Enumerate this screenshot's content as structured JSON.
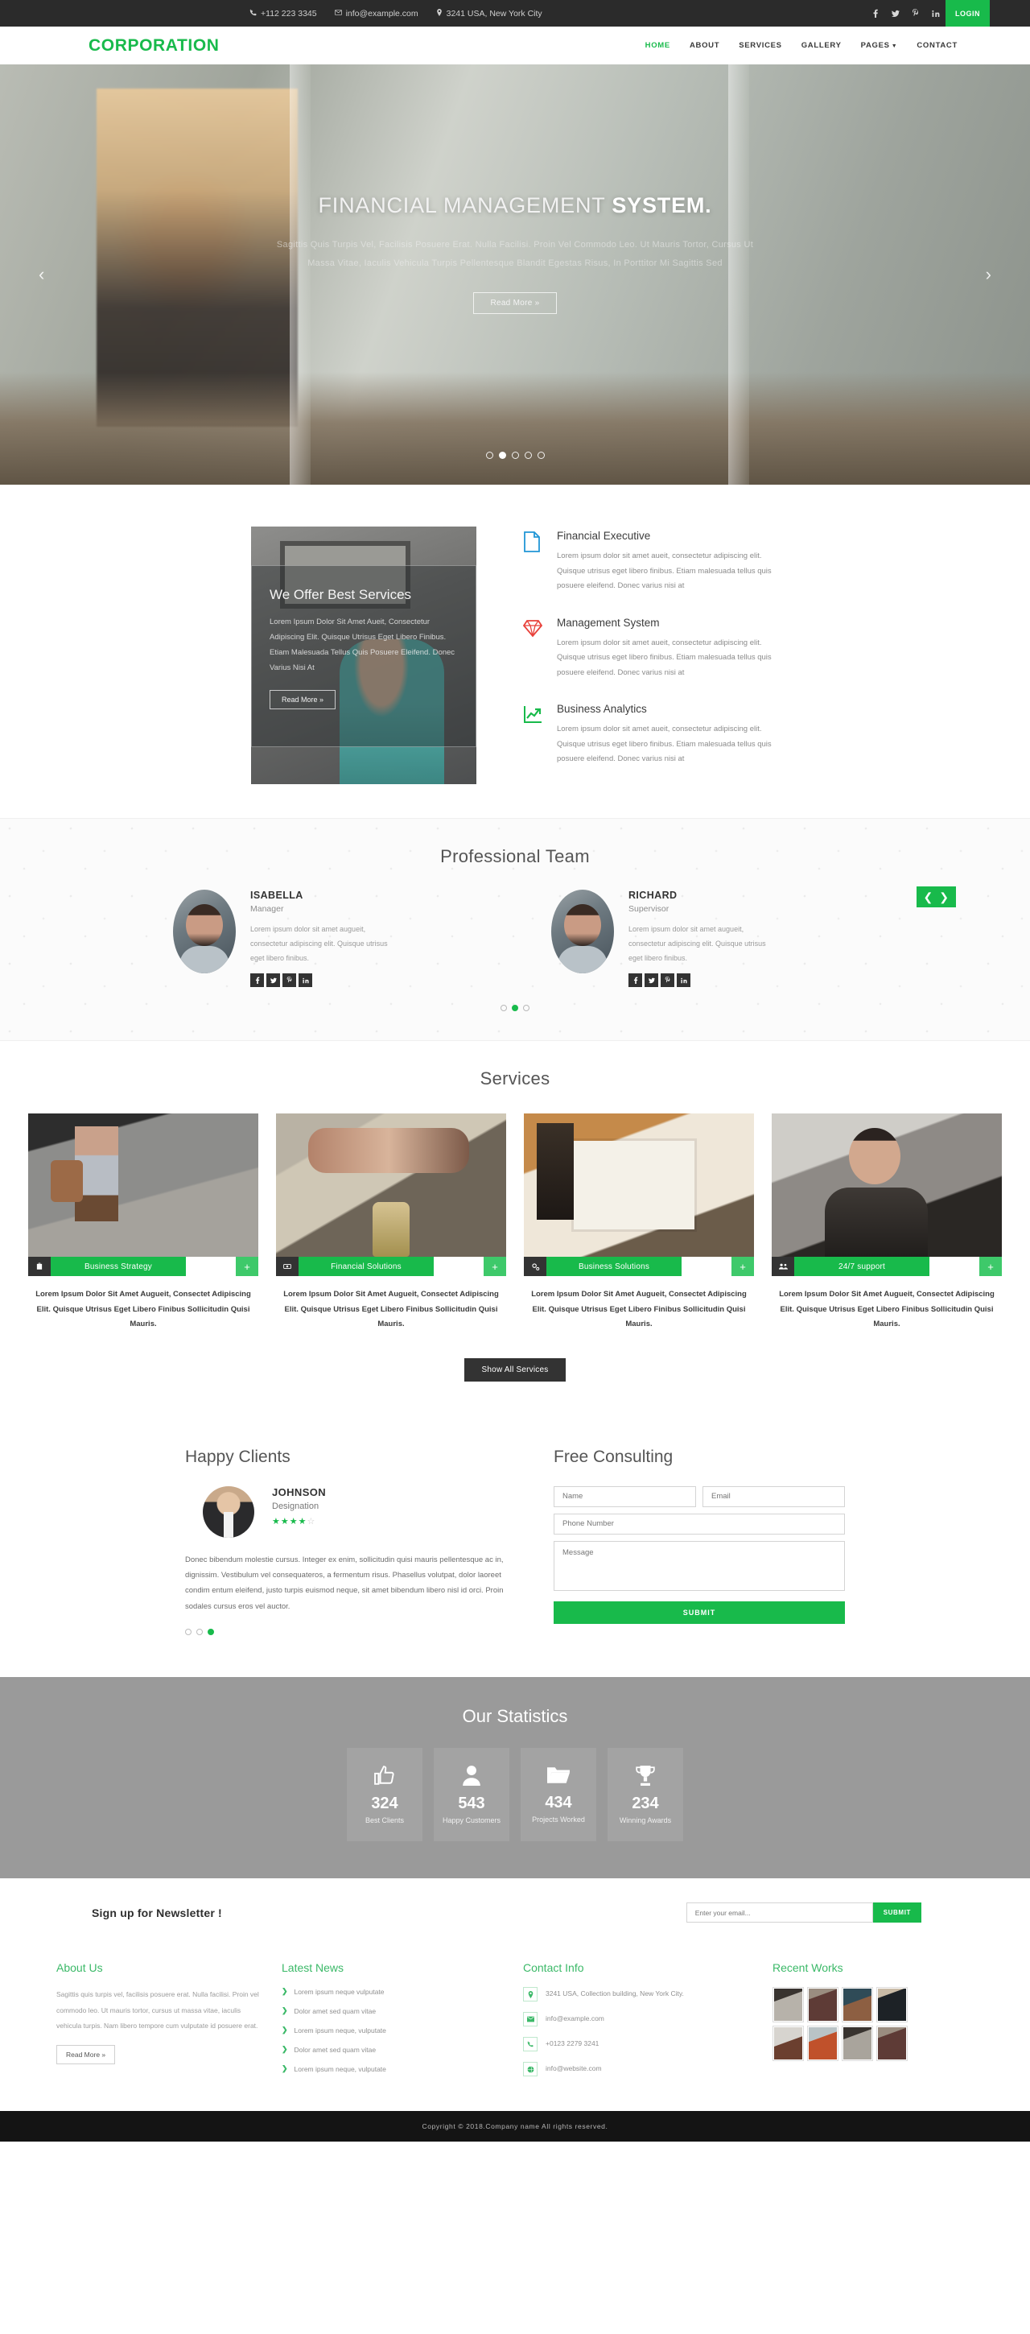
{
  "colors": {
    "accent": "#18ba4b",
    "dark": "#2b2b2b",
    "footer_heading": "#3bb968",
    "stats_bg": "#9a9a9a"
  },
  "topbar": {
    "phone": "+112 223 3345",
    "email": "info@example.com",
    "address": "3241 USA, New York City",
    "social": [
      "facebook-icon",
      "twitter-icon",
      "pinterest-icon",
      "linkedin-icon"
    ],
    "login_label": "LOGIN"
  },
  "nav": {
    "brand": "CORPORATION",
    "items": [
      {
        "label": "HOME",
        "active": true
      },
      {
        "label": "ABOUT",
        "active": false
      },
      {
        "label": "SERVICES",
        "active": false
      },
      {
        "label": "GALLERY",
        "active": false
      },
      {
        "label": "PAGES",
        "active": false,
        "caret": true
      },
      {
        "label": "CONTACT",
        "active": false
      }
    ]
  },
  "hero": {
    "title_light": "FINANCIAL MANAGEMENT ",
    "title_bold": "SYSTEM.",
    "subtitle": "Sagittis Quis Turpis Vel, Facilisis Posuere Erat. Nulla Facilisi. Proin Vel Commodo Leo. Ut Mauris Tortor, Cursus Ut Massa Vitae, Iaculis Vehicula Turpis Pellentesque Blandit Egestas Risus, In Porttitor Mi Sagittis Sed",
    "button": "Read More »",
    "prev_arrow": "‹",
    "next_arrow": "›",
    "dots_total": 5,
    "dot_active": 2
  },
  "offer": {
    "title": "We Offer Best Services",
    "text": "Lorem Ipsum Dolor Sit Amet Aueit, Consectetur Adipiscing Elit. Quisque Utrisus Eget Libero Finibus. Etiam Malesuada Tellus Quis Posuere Eleifend. Donec Varius Nisi At",
    "button": "Read More »"
  },
  "features": [
    {
      "icon": "document-icon",
      "title": "Financial Executive",
      "text": "Lorem ipsum dolor sit amet aueit, consectetur adipiscing elit. Quisque utrisus eget libero finibus. Etiam malesuada tellus quis posuere eleifend. Donec varius nisi at"
    },
    {
      "icon": "diamond-icon",
      "title": "Management System",
      "text": "Lorem ipsum dolor sit amet aueit, consectetur adipiscing elit. Quisque utrisus eget libero finibus. Etiam malesuada tellus quis posuere eleifend. Donec varius nisi at"
    },
    {
      "icon": "chart-growth-icon",
      "title": "Business Analytics",
      "text": "Lorem ipsum dolor sit amet aueit, consectetur adipiscing elit. Quisque utrisus eget libero finibus. Etiam malesuada tellus quis posuere eleifend. Donec varius nisi at"
    }
  ],
  "team": {
    "title": "Professional Team",
    "members": [
      {
        "name": "ISABELLA",
        "role": "Manager",
        "text": "Lorem ipsum dolor sit amet augueit, consectetur adipiscing elit. Quisque utrisus eget libero finibus."
      },
      {
        "name": "RICHARD",
        "role": "Supervisor",
        "text": "Lorem ipsum dolor sit amet augueit, consectetur adipiscing elit. Quisque utrisus eget libero finibus."
      }
    ],
    "social": [
      "facebook-icon",
      "twitter-icon",
      "pinterest-icon",
      "linkedin-icon"
    ],
    "prev_arrow": "❮",
    "next_arrow": "❯",
    "dots_total": 3,
    "dot_active": 2
  },
  "services": {
    "title": "Services",
    "show_all_label": "Show All Services",
    "items": [
      {
        "label": "Business Strategy",
        "icon": "briefcase-icon",
        "plus": "+",
        "desc": "Lorem Ipsum Dolor Sit Amet Augueit, Consectet Adipiscing Elit. Quisque Utrisus Eget Libero Finibus Sollicitudin Quisi Mauris."
      },
      {
        "label": "Financial Solutions",
        "icon": "money-icon",
        "plus": "+",
        "desc": "Lorem Ipsum Dolor Sit Amet Augueit, Consectet Adipiscing Elit. Quisque Utrisus Eget Libero Finibus Sollicitudin Quisi Mauris."
      },
      {
        "label": "Business Solutions",
        "icon": "gears-icon",
        "plus": "+",
        "desc": "Lorem Ipsum Dolor Sit Amet Augueit, Consectet Adipiscing Elit. Quisque Utrisus Eget Libero Finibus Sollicitudin Quisi Mauris."
      },
      {
        "label": "24/7 support",
        "icon": "users-icon",
        "plus": "+",
        "desc": "Lorem Ipsum Dolor Sit Amet Augueit, Consectet Adipiscing Elit. Quisque Utrisus Eget Libero Finibus Sollicitudin Quisi Mauris."
      }
    ]
  },
  "clients": {
    "title": "Happy Clients",
    "name": "JOHNSON",
    "role": "Designation",
    "rating": 4,
    "rating_max": 5,
    "quote": "Donec bibendum molestie cursus. Integer ex enim, sollicitudin quisi mauris pellentesque ac in, dignissim. Vestibulum vel consequateros, a fermentum risus. Phasellus volutpat, dolor laoreet condim entum eleifend, justo turpis euismod neque, sit amet bibendum libero nisl id orci. Proin sodales cursus eros vel auctor.",
    "dots_total": 3,
    "dot_active": 3
  },
  "consult": {
    "title": "Free Consulting",
    "name_placeholder": "Name",
    "email_placeholder": "Email",
    "phone_placeholder": "Phone Number",
    "message_placeholder": "Message",
    "submit_label": "SUBMIT"
  },
  "stats": {
    "title": "Our Statistics",
    "items": [
      {
        "icon": "thumbs-up-icon",
        "number": "324",
        "label": "Best Clients"
      },
      {
        "icon": "user-icon",
        "number": "543",
        "label": "Happy Customers"
      },
      {
        "icon": "folder-icon",
        "number": "434",
        "label": "Projects Worked"
      },
      {
        "icon": "trophy-icon",
        "number": "234",
        "label": "Winning Awards"
      }
    ]
  },
  "newsletter": {
    "title": "Sign up for Newsletter !",
    "placeholder": "Enter your email...",
    "submit_label": "SUBMIT"
  },
  "footer": {
    "about": {
      "heading": "About Us",
      "text": "Sagittis quis turpis vel, facilisis posuere erat. Nulla facilisi. Proin vel commodo leo. Ut mauris tortor, cursus ut massa vitae, iaculis vehicula turpis. Nam libero tempore cum vulputate id posuere erat.",
      "button": "Read More »"
    },
    "news": {
      "heading": "Latest News",
      "items": [
        "Lorem ipsum neque vulputate",
        "Dolor amet sed quam vitae",
        "Lorem ipsum neque, vulputate",
        "Dolor amet sed quam vitae",
        "Lorem ipsum neque, vulputate"
      ]
    },
    "contact": {
      "heading": "Contact Info",
      "items": [
        {
          "icon": "location-pin-icon",
          "text": "3241 USA, Collection building, New York City."
        },
        {
          "icon": "envelope-icon",
          "text": "info@example.com"
        },
        {
          "icon": "phone-icon",
          "text": "+0123 2279 3241"
        },
        {
          "icon": "globe-icon",
          "text": "info@website.com"
        }
      ]
    },
    "works": {
      "heading": "Recent Works",
      "thumbs": [
        "work-1",
        "work-2",
        "work-3",
        "work-4",
        "work-5",
        "work-6",
        "work-7",
        "work-8"
      ]
    }
  },
  "copyright": "Copyright © 2018.Company name All rights reserved."
}
